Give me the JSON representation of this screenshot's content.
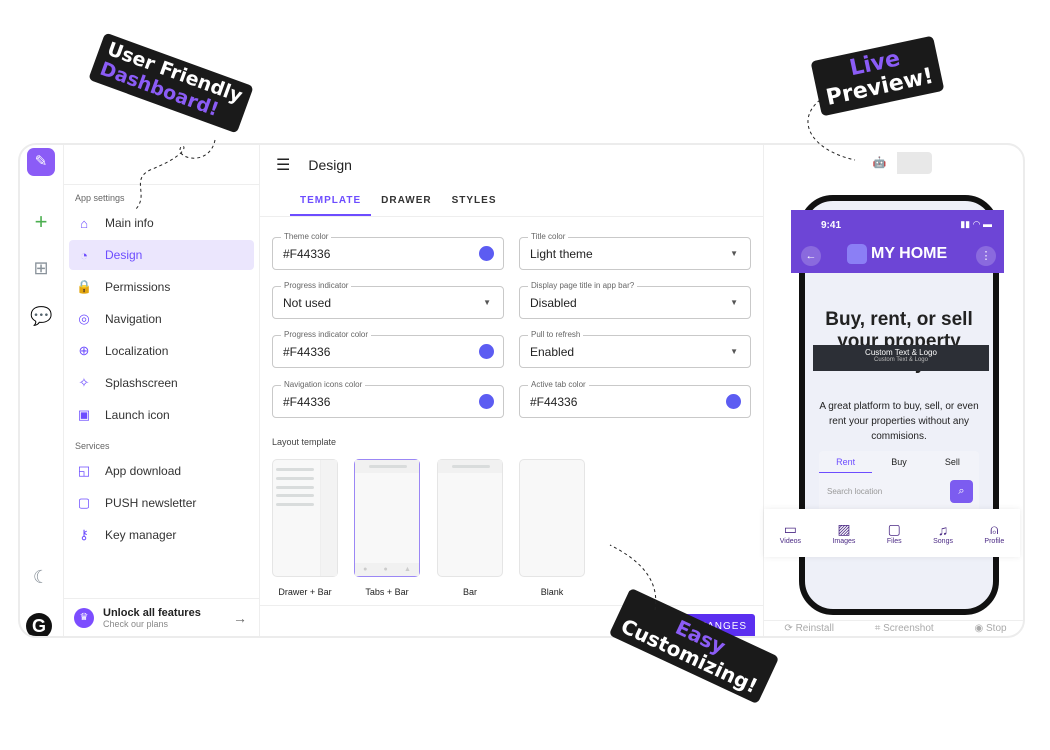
{
  "rail": {
    "icons": [
      "app-logo",
      "plus-icon",
      "apps-grid-icon",
      "chat-icon",
      "moon-icon",
      "g-logo"
    ]
  },
  "sidebar": {
    "section1": "App settings",
    "items": [
      {
        "label": "Main info",
        "icon": "⌂"
      },
      {
        "label": "Design",
        "icon": "◔"
      },
      {
        "label": "Permissions",
        "icon": "🔒"
      },
      {
        "label": "Navigation",
        "icon": "◎"
      },
      {
        "label": "Localization",
        "icon": "⊕"
      },
      {
        "label": "Splashscreen",
        "icon": "✧"
      },
      {
        "label": "Launch icon",
        "icon": "▣"
      }
    ],
    "section2": "Services",
    "services": [
      {
        "label": "App download",
        "icon": "◱"
      },
      {
        "label": "PUSH newsletter",
        "icon": "▢"
      },
      {
        "label": "Key manager",
        "icon": "⚷"
      }
    ],
    "unlock": {
      "title": "Unlock all features",
      "subtitle": "Check our plans"
    }
  },
  "main": {
    "title": "Design",
    "tabs": [
      "TEMPLATE",
      "DRAWER",
      "STYLES"
    ],
    "fields": [
      {
        "label": "Theme color",
        "value": "#F44336",
        "type": "color"
      },
      {
        "label": "Title color",
        "value": "Light theme",
        "type": "select"
      },
      {
        "label": "Progress indicator",
        "value": "Not used",
        "type": "select"
      },
      {
        "label": "Display page title in app bar?",
        "value": "Disabled",
        "type": "select"
      },
      {
        "label": "Progress indicator color",
        "value": "#F44336",
        "type": "color"
      },
      {
        "label": "Pull to refresh",
        "value": "Enabled",
        "type": "select"
      },
      {
        "label": "Navigation icons color",
        "value": "#F44336",
        "type": "color"
      },
      {
        "label": "Active tab color",
        "value": "#F44336",
        "type": "color"
      }
    ],
    "layout_label": "Layout template",
    "templates": [
      "Drawer + Bar",
      "Tabs + Bar",
      "Bar",
      "Blank"
    ],
    "selected_template": "Tabs + Bar",
    "save": "SAVE CHANGES"
  },
  "preview": {
    "time": "9:41",
    "app_name": "MY HOME",
    "custom_title": "Custom Text & Logo",
    "custom_sub": "Custom Text & Logo",
    "headline": "Buy, rent, or sell your property easily",
    "body": "A great platform to buy, sell, or even rent your properties without any commisions.",
    "tabs": [
      "Rent",
      "Buy",
      "Sell"
    ],
    "search_placeholder": "Search location",
    "nav": [
      "Videos",
      "Images",
      "Files",
      "Songs",
      "Profile"
    ],
    "actions": [
      "Reinstall",
      "Screenshot",
      "Stop"
    ]
  },
  "stickers": {
    "s1a": "User Friendly",
    "s1b": "Dashboard!",
    "s2a": "Live",
    "s2b": "Preview!",
    "s3a": "Easy",
    "s3b": "Customizing!"
  },
  "colors": {
    "accent": "#6d4dff",
    "appbar": "#6d45d6",
    "swatch": "#5c5cf2"
  }
}
